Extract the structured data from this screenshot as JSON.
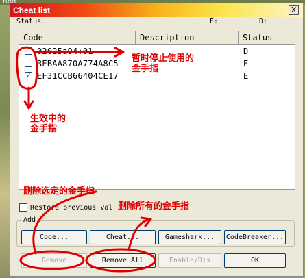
{
  "window": {
    "title": "Cheat list",
    "close_label": "X"
  },
  "status_bar": {
    "label": "Status",
    "e_label": "E:",
    "d_label": "D:"
  },
  "list": {
    "columns": [
      "Code",
      "Description",
      "Status"
    ],
    "rows": [
      {
        "checked": false,
        "code": "02025a94:01",
        "description": "",
        "status": "D"
      },
      {
        "checked": false,
        "code": "3EBAA870A774A8C5",
        "description": "",
        "status": "E"
      },
      {
        "checked": true,
        "code": "EF31CCB66404CE17",
        "description": "",
        "status": "E"
      }
    ]
  },
  "restore": {
    "label": "Restore previous val",
    "checked": false
  },
  "add_group": {
    "label": "Add",
    "buttons": [
      "Code...",
      "Cheat...",
      "Gameshark...",
      "CodeBreaker..."
    ]
  },
  "bottom_buttons": {
    "remove": "Remove",
    "remove_all": "Remove All",
    "enable_disable": "Enable/Dis",
    "ok": "OK"
  },
  "annotations": {
    "paused_cheat": "暂时停止使用的\n金手指",
    "active_cheat": "生效中的\n金手指",
    "delete_selected": "删除选定的金手指",
    "delete_all": "删除所有的金手指",
    "color": "#e00000"
  },
  "top_fragment": "Bod"
}
